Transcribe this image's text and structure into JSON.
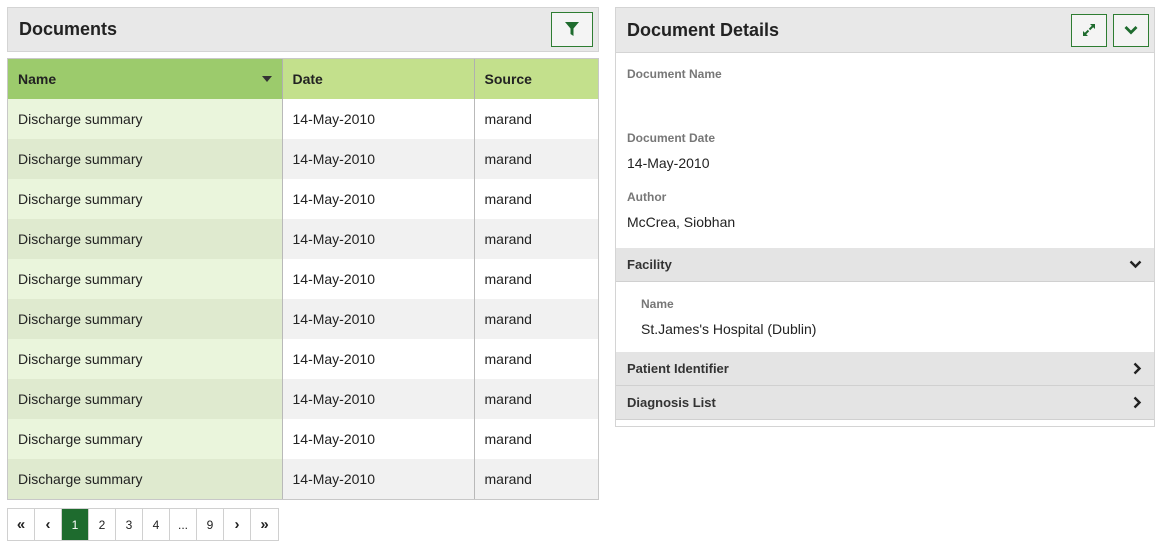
{
  "documents": {
    "title": "Documents",
    "filter_icon": "filter-icon",
    "columns": [
      "Name",
      "Date",
      "Source"
    ],
    "rows": [
      {
        "name": "Discharge summary",
        "date": "14-May-2010",
        "source": "marand"
      },
      {
        "name": "Discharge summary",
        "date": "14-May-2010",
        "source": "marand"
      },
      {
        "name": "Discharge summary",
        "date": "14-May-2010",
        "source": "marand"
      },
      {
        "name": "Discharge summary",
        "date": "14-May-2010",
        "source": "marand"
      },
      {
        "name": "Discharge summary",
        "date": "14-May-2010",
        "source": "marand"
      },
      {
        "name": "Discharge summary",
        "date": "14-May-2010",
        "source": "marand"
      },
      {
        "name": "Discharge summary",
        "date": "14-May-2010",
        "source": "marand"
      },
      {
        "name": "Discharge summary",
        "date": "14-May-2010",
        "source": "marand"
      },
      {
        "name": "Discharge summary",
        "date": "14-May-2010",
        "source": "marand"
      },
      {
        "name": "Discharge summary",
        "date": "14-May-2010",
        "source": "marand"
      }
    ],
    "pager": {
      "first": "«",
      "prev": "‹",
      "pages": [
        "1",
        "2",
        "3",
        "4",
        "...",
        "9"
      ],
      "active": "1",
      "next": "›",
      "last": "»"
    }
  },
  "details": {
    "title": "Document Details",
    "expand_icon": "expand-icon",
    "collapse_icon": "chevron-down-icon",
    "document_name_label": "Document Name",
    "document_name_value": "",
    "document_date_label": "Document Date",
    "document_date_value": "14-May-2010",
    "author_label": "Author",
    "author_value": "McCrea, Siobhan",
    "facility": {
      "title": "Facility",
      "name_label": "Name",
      "name_value": "St.James's Hospital (Dublin)"
    },
    "patient_identifier": {
      "title": "Patient Identifier"
    },
    "diagnosis_list": {
      "title": "Diagnosis List"
    }
  },
  "colors": {
    "accent": "#1e6b2e",
    "header_green": "#c3e08c",
    "sorted_green": "#9ccb6c"
  }
}
